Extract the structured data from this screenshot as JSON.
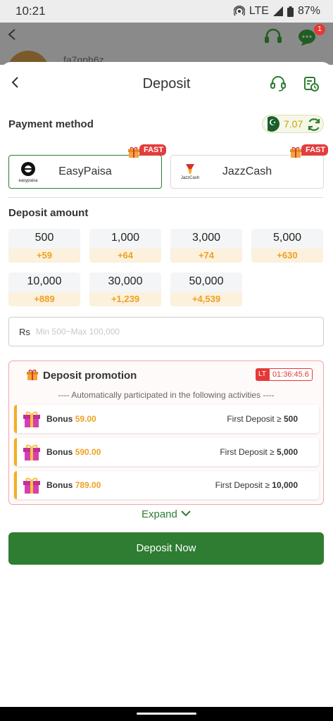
{
  "status_bar": {
    "time": "10:21",
    "network": "LTE",
    "battery": "87%"
  },
  "background": {
    "username": "fa7gph6z",
    "chat_badge": "1"
  },
  "header": {
    "title": "Deposit"
  },
  "payment": {
    "title": "Payment method",
    "balance": "7.07",
    "methods": [
      {
        "name": "EasyPaisa",
        "badge": "FAST",
        "logo_text": "easypaisa",
        "selected": true
      },
      {
        "name": "JazzCash",
        "badge": "FAST",
        "logo_text": "JazzCash",
        "selected": false
      }
    ]
  },
  "amount": {
    "title": "Deposit amount",
    "options": [
      {
        "value": "500",
        "bonus": "+59"
      },
      {
        "value": "1,000",
        "bonus": "+64"
      },
      {
        "value": "3,000",
        "bonus": "+74"
      },
      {
        "value": "5,000",
        "bonus": "+630"
      },
      {
        "value": "10,000",
        "bonus": "+889"
      },
      {
        "value": "30,000",
        "bonus": "+1,239"
      },
      {
        "value": "50,000",
        "bonus": "+4,539"
      }
    ],
    "currency_label": "Rs",
    "placeholder": "Min 500~Max 100,000"
  },
  "promotion": {
    "title": "Deposit promotion",
    "lt_label": "LT",
    "timer": "01:36:45.6",
    "subtitle": "---- Automatically participated in the following activities ----",
    "items": [
      {
        "label": "Bonus",
        "value": "59.00",
        "condition": "First Deposit ≥",
        "threshold": "500"
      },
      {
        "label": "Bonus",
        "value": "590.00",
        "condition": "First Deposit ≥",
        "threshold": "5,000"
      },
      {
        "label": "Bonus",
        "value": "789.00",
        "condition": "First Deposit ≥",
        "threshold": "10,000"
      }
    ]
  },
  "expand_label": "Expand",
  "deposit_button": "Deposit Now",
  "colors": {
    "primary": "#2e7d32",
    "accent": "#f0a020",
    "danger": "#e53935"
  }
}
